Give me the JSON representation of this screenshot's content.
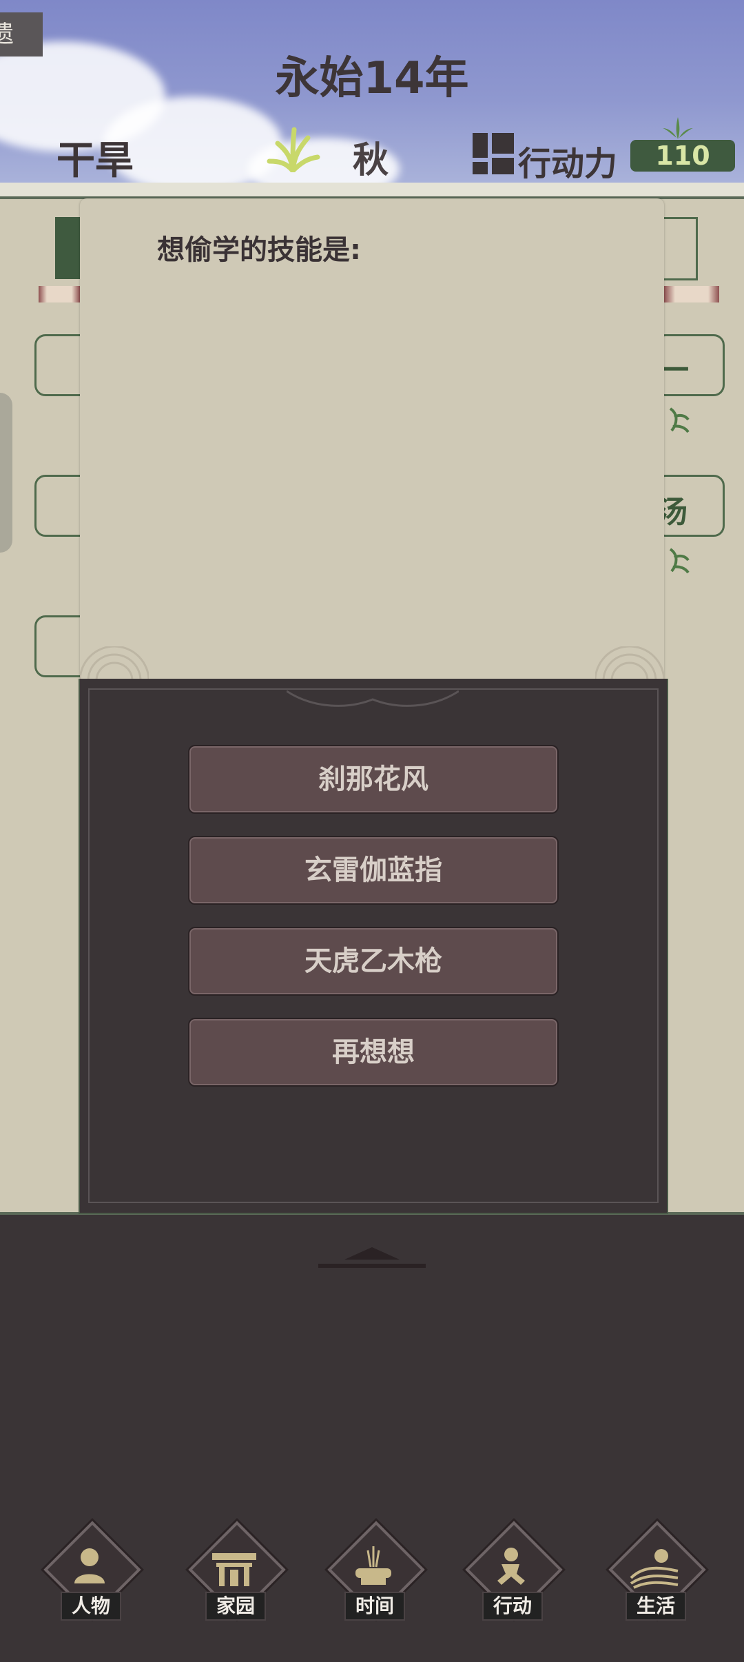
{
  "header": {
    "corner_tag": "遗",
    "year_title": "永始14年",
    "weather": "干旱",
    "season": "秋",
    "action_points_label": "行动力",
    "action_points_value": "110"
  },
  "background_panel": {
    "visible_fragments": [
      "一",
      "汤"
    ]
  },
  "dialog": {
    "title": "想偷学的技能是:",
    "options": [
      {
        "label": "刹那花风"
      },
      {
        "label": "玄雷伽蓝指"
      },
      {
        "label": "天虎乙木枪"
      },
      {
        "label": "再想想"
      }
    ]
  },
  "bottom_nav": {
    "items": [
      {
        "label": "人物",
        "icon": "person-icon"
      },
      {
        "label": "家园",
        "icon": "gate-icon"
      },
      {
        "label": "时间",
        "icon": "incense-icon"
      },
      {
        "label": "行动",
        "icon": "action-figure-icon"
      },
      {
        "label": "生活",
        "icon": "sun-fields-icon"
      }
    ]
  },
  "colors": {
    "sky": "#8f98cf",
    "panel": "#cfc9b5",
    "dark": "#3a3436",
    "accent_green": "#3f5a3f",
    "button": "#5e4b4d"
  }
}
